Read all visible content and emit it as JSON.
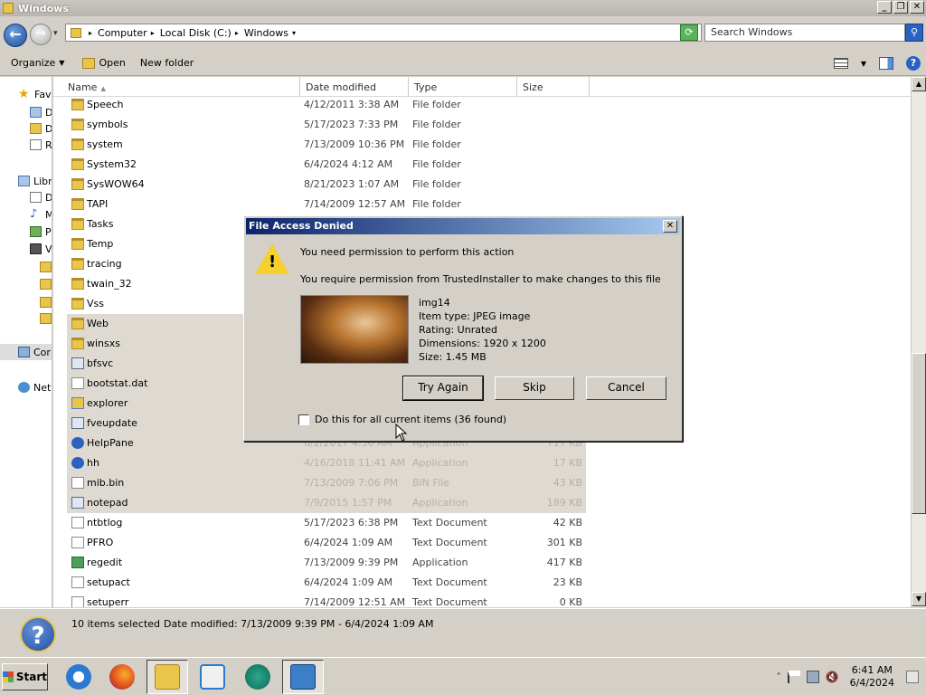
{
  "window": {
    "title": "Windows"
  },
  "address": {
    "crumbs": [
      "Computer",
      "Local Disk (C:)",
      "Windows"
    ],
    "search_placeholder": "Search Windows"
  },
  "toolbar": {
    "organize": "Organize",
    "open": "Open",
    "new_folder": "New folder"
  },
  "nav": {
    "favorites": "Fav",
    "libraries": "Libr",
    "computer": "Cor",
    "network": "Net",
    "sub_d1": "D",
    "sub_d2": "D",
    "sub_r": "R",
    "lib_d": "D",
    "lib_m": "M",
    "lib_p": "P",
    "lib_v": "V"
  },
  "columns": {
    "name": "Name",
    "date": "Date modified",
    "type": "Type",
    "size": "Size"
  },
  "files": [
    {
      "name": "Speech",
      "date": "4/12/2011 3:38 AM",
      "type": "File folder",
      "size": "",
      "icon": "folder"
    },
    {
      "name": "symbols",
      "date": "5/17/2023 7:33 PM",
      "type": "File folder",
      "size": "",
      "icon": "folder"
    },
    {
      "name": "system",
      "date": "7/13/2009 10:36 PM",
      "type": "File folder",
      "size": "",
      "icon": "folder"
    },
    {
      "name": "System32",
      "date": "6/4/2024 4:12 AM",
      "type": "File folder",
      "size": "",
      "icon": "folder"
    },
    {
      "name": "SysWOW64",
      "date": "8/21/2023 1:07 AM",
      "type": "File folder",
      "size": "",
      "icon": "folder"
    },
    {
      "name": "TAPI",
      "date": "7/14/2009 12:57 AM",
      "type": "File folder",
      "size": "",
      "icon": "folder"
    },
    {
      "name": "Tasks",
      "date": "",
      "type": "",
      "size": "",
      "icon": "folder"
    },
    {
      "name": "Temp",
      "date": "",
      "type": "",
      "size": "",
      "icon": "folder"
    },
    {
      "name": "tracing",
      "date": "",
      "type": "",
      "size": "",
      "icon": "folder"
    },
    {
      "name": "twain_32",
      "date": "",
      "type": "",
      "size": "",
      "icon": "folder"
    },
    {
      "name": "Vss",
      "date": "",
      "type": "",
      "size": "",
      "icon": "folder"
    },
    {
      "name": "Web",
      "date": "",
      "type": "",
      "size": "",
      "icon": "folder"
    },
    {
      "name": "winsxs",
      "date": "",
      "type": "",
      "size": "",
      "icon": "folder"
    },
    {
      "name": "bfsvc",
      "date": "",
      "type": "",
      "size": "",
      "icon": "app"
    },
    {
      "name": "bootstat.dat",
      "date": "",
      "type": "",
      "size": "",
      "icon": "txt"
    },
    {
      "name": "explorer",
      "date": "",
      "type": "",
      "size": "",
      "icon": "exp"
    },
    {
      "name": "fveupdate",
      "date": "",
      "type": "",
      "size": "",
      "icon": "app"
    },
    {
      "name": "HelpPane",
      "date": "6/2/2017 4:30 AM",
      "type": "Application",
      "size": "717 KB",
      "icon": "help"
    },
    {
      "name": "hh",
      "date": "4/16/2018 11:41 AM",
      "type": "Application",
      "size": "17 KB",
      "icon": "help"
    },
    {
      "name": "mib.bin",
      "date": "7/13/2009 7:06 PM",
      "type": "BIN File",
      "size": "43 KB",
      "icon": "txt"
    },
    {
      "name": "notepad",
      "date": "7/9/2015 1:57 PM",
      "type": "Application",
      "size": "189 KB",
      "icon": "app"
    },
    {
      "name": "ntbtlog",
      "date": "5/17/2023 6:38 PM",
      "type": "Text Document",
      "size": "42 KB",
      "icon": "txt"
    },
    {
      "name": "PFRO",
      "date": "6/4/2024 1:09 AM",
      "type": "Text Document",
      "size": "301 KB",
      "icon": "txt"
    },
    {
      "name": "regedit",
      "date": "7/13/2009 9:39 PM",
      "type": "Application",
      "size": "417 KB",
      "icon": "reg"
    },
    {
      "name": "setupact",
      "date": "6/4/2024 1:09 AM",
      "type": "Text Document",
      "size": "23 KB",
      "icon": "txt"
    },
    {
      "name": "setuperr",
      "date": "7/14/2009 12:51 AM",
      "type": "Text Document",
      "size": "0 KB",
      "icon": "txt"
    }
  ],
  "details": {
    "count": "10 items selected",
    "date_modified": "Date modified: 7/13/2009 9:39 PM - 6/4/2024 1:09 AM"
  },
  "dialog": {
    "title": "File Access Denied",
    "heading": "You need permission to perform this action",
    "message": "You require permission from TrustedInstaller to make changes to this file",
    "item_name": "img14",
    "item_type": "Item type: JPEG image",
    "rating": "Rating: Unrated",
    "dimensions": "Dimensions: 1920 x 1200",
    "size": "Size: 1.45 MB",
    "try_again": "Try Again",
    "skip": "Skip",
    "cancel": "Cancel",
    "apply_all": "Do this for all current items (36 found)"
  },
  "taskbar": {
    "start": "Start",
    "time": "6:41 AM",
    "date": "6/4/2024"
  }
}
